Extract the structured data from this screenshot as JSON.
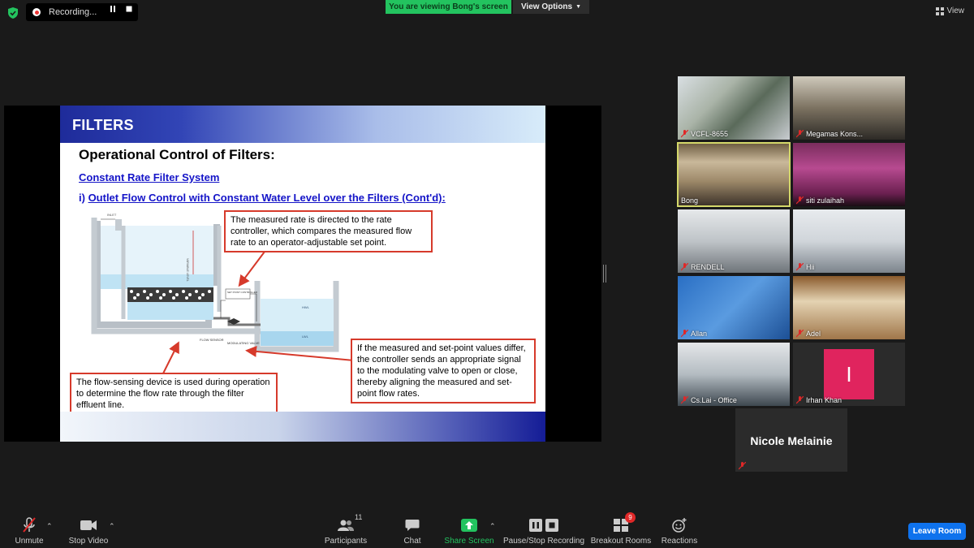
{
  "top_bar": {
    "recording_label": "Recording...",
    "viewing_banner": "You are viewing Bong's screen",
    "view_options_label": "View Options",
    "view_button_label": "View"
  },
  "slide": {
    "header_title": "FILTERS",
    "heading": "Operational Control of Filters:",
    "subheading_1": "Constant Rate Filter System",
    "subheading_2_prefix": "i) ",
    "subheading_2": "Outlet Flow Control with Constant Water Level over the Filters (Cont'd):",
    "callout_top": "The measured rate is directed to the rate controller, which compares the measured flow rate to an operator-adjustable set point.",
    "callout_left": "The flow-sensing device is used during operation to determine the flow rate through the filter effluent line.",
    "callout_right": "If the measured and set-point values differ, the controller sends an appropriate signal to the modulating valve to open or close, thereby aligning the measured and set-point flow rates.",
    "diagram_labels": {
      "inlet": "INLET",
      "variable_level": "VARIABLE LEVEL",
      "set_point_controller": "SET POINT CONTROLLER",
      "hwl": "HWL",
      "lwl": "LWL",
      "flow_sensor": "FLOW SENSOR",
      "modulating_valve": "MODULATING VALVE"
    }
  },
  "participants": [
    {
      "name": "VCFL-8655",
      "muted": true
    },
    {
      "name": "Megamas Kons...",
      "muted": true
    },
    {
      "name": "Bong",
      "muted": false,
      "active": true
    },
    {
      "name": "siti zulaihah",
      "muted": true
    },
    {
      "name": "RENDELL",
      "muted": true
    },
    {
      "name": "Hii",
      "muted": true
    },
    {
      "name": "Allan",
      "muted": true
    },
    {
      "name": "Adel",
      "muted": true
    },
    {
      "name": "Cs.Lai - Office",
      "muted": true
    },
    {
      "name": "Irhan Khan",
      "muted": true,
      "avatar_letter": "I"
    },
    {
      "name": "Nicole Melainie",
      "muted": true
    }
  ],
  "toolbar": {
    "unmute": "Unmute",
    "stop_video": "Stop Video",
    "participants": "Participants",
    "participant_count": "11",
    "chat": "Chat",
    "share_screen": "Share Screen",
    "pause_stop_recording": "Pause/Stop Recording",
    "breakout_rooms": "Breakout Rooms",
    "breakout_badge": "9",
    "reactions": "Reactions",
    "leave_room": "Leave Room"
  },
  "colors": {
    "accent_green": "#23c35f",
    "leave_blue": "#0e72ed",
    "callout_border": "#d63a2b",
    "slide_link_blue": "#1414c8",
    "avatar_pink": "#e0245e"
  }
}
